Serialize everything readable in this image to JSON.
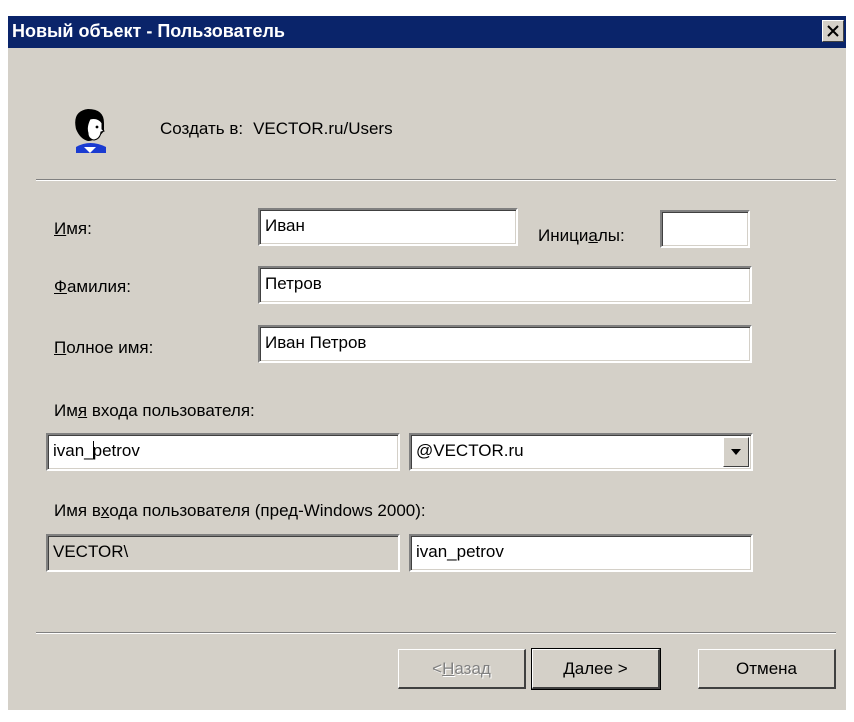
{
  "window": {
    "title": "Новый объект - Пользователь"
  },
  "header": {
    "create_in_label": "Создать в:",
    "create_in_path": "VECTOR.ru/Users",
    "icon": "user-icon"
  },
  "form": {
    "first_name_label_u": "И",
    "first_name_label_rest": "мя:",
    "first_name_value": "Иван",
    "initials_label_a": "Иници",
    "initials_label_u": "а",
    "initials_label_b": "лы:",
    "initials_value": "",
    "last_name_label_u": "Ф",
    "last_name_label_rest": "амилия:",
    "last_name_value": "Петров",
    "full_name_label_u": "П",
    "full_name_label_rest": "олное имя:",
    "full_name_value": "Иван Петров",
    "logon_label_a": "Им",
    "logon_label_u": "я",
    "logon_label_b": " входа пользователя:",
    "logon_value_a": "ivan_",
    "logon_value_b": "petrov",
    "domain_value": "@VECTOR.ru",
    "pre2000_label_a": "Имя в",
    "pre2000_label_u": "х",
    "pre2000_label_b": "ода пользователя (пред-Windows 2000):",
    "pre2000_domain": "VECTOR\\",
    "pre2000_value": "ivan_petrov"
  },
  "buttons": {
    "back_prefix": "< ",
    "back_u": "Н",
    "back_rest": "азад",
    "next_u": "Д",
    "next_rest": "алее >",
    "cancel": "Отмена"
  }
}
